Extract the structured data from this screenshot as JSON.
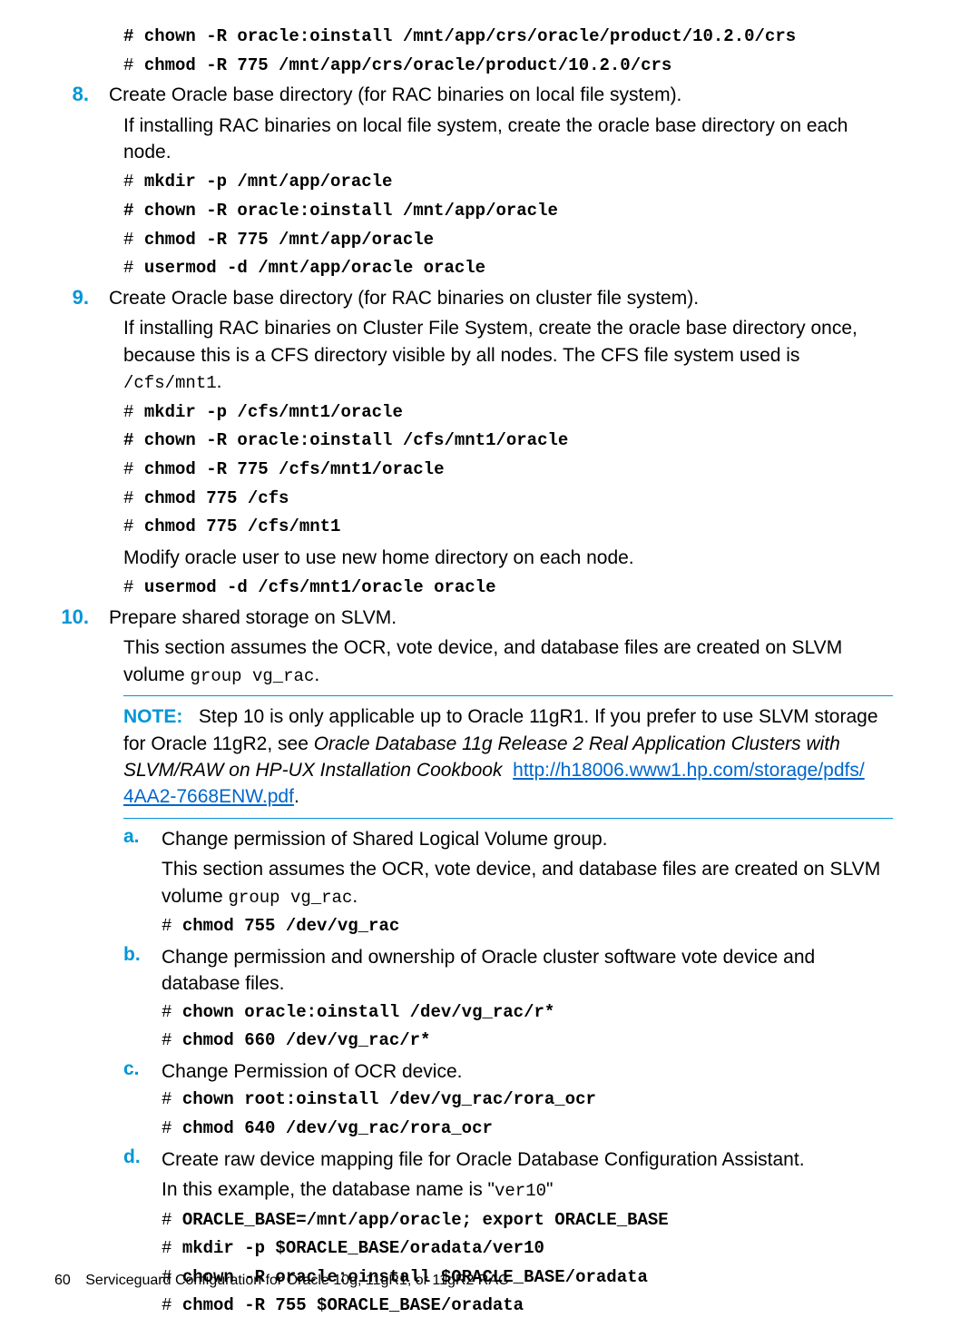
{
  "lines": {
    "l1": "# chown -R oracle:oinstall /mnt/app/crs/oracle/product/10.2.0/crs",
    "l2_pre": "# ",
    "l2_cmd": "chmod -R 775 /mnt/app/crs/oracle/product/10.2.0/crs"
  },
  "step8": {
    "num": "8.",
    "text": "Create Oracle base directory (for RAC binaries on local file system).",
    "para": "If installing RAC binaries on local file system, create the oracle base directory on each node.",
    "c1_pre": "# ",
    "c1_cmd": "mkdir -p /mnt/app/oracle",
    "c2": "# chown -R oracle:oinstall /mnt/app/oracle",
    "c3_pre": "# ",
    "c3_cmd": "chmod -R 775 /mnt/app/oracle",
    "c4_pre": "# ",
    "c4_cmd": "usermod -d /mnt/app/oracle oracle"
  },
  "step9": {
    "num": "9.",
    "text": "Create Oracle base directory (for RAC binaries on cluster file system).",
    "para_a": "If installing RAC binaries on Cluster File System, create the oracle base directory once, because this is a CFS directory visible by all nodes. The CFS file system used is ",
    "para_mono": "/cfs/mnt1",
    "para_end": ".",
    "c1_pre": "# ",
    "c1_cmd": "mkdir -p /cfs/mnt1/oracle",
    "c2": "# chown -R oracle:oinstall /cfs/mnt1/oracle",
    "c3_pre": "# ",
    "c3_cmd": "chmod -R 775 /cfs/mnt1/oracle",
    "c4_pre": "# ",
    "c4_cmd": "chmod 775 /cfs",
    "c5_pre": "# ",
    "c5_cmd": "chmod 775 /cfs/mnt1",
    "para2": "Modify oracle user to use new home directory on each node.",
    "c6_pre": "# ",
    "c6_cmd": "usermod -d /cfs/mnt1/oracle oracle"
  },
  "step10": {
    "num": "10.",
    "text": "Prepare shared storage on SLVM.",
    "para_a": "This section assumes the OCR, vote device, and database files are created on SLVM volume ",
    "para_mono": "group vg_rac",
    "para_end": "."
  },
  "note": {
    "label": "NOTE:",
    "t1": "Step 10 is only applicable up to Oracle 11gR1. If you prefer to use SLVM storage for Oracle 11gR2, see ",
    "italic": "Oracle Database 11g Release 2 Real Application Clusters with SLVM/RAW on HP-UX Installation Cookbook",
    "link1": "http://h18006.www1.hp.com/storage/pdfs/",
    "link2": "4AA2-7668ENW.pdf",
    "after": "."
  },
  "sub_a": {
    "label": "a.",
    "text": "Change permission of Shared Logical Volume group.",
    "para_a": "This section assumes the OCR, vote device, and database files are created on SLVM volume ",
    "para_mono": "group vg_rac",
    "para_end": ".",
    "c1_pre": "# ",
    "c1_cmd": "chmod 755 /dev/vg_rac"
  },
  "sub_b": {
    "label": "b.",
    "text": "Change permission and ownership of Oracle cluster software vote device and database files.",
    "c1_pre": "# ",
    "c1_cmd": "chown oracle:oinstall /dev/vg_rac/r*",
    "c2_pre": "# ",
    "c2_cmd": "chmod 660 /dev/vg_rac/r*"
  },
  "sub_c": {
    "label": "c.",
    "text": "Change Permission of OCR device.",
    "c1_pre": "# ",
    "c1_cmd": "chown root:oinstall /dev/vg_rac/rora_ocr",
    "c2_pre": "# ",
    "c2_cmd": "chmod 640 /dev/vg_rac/rora_ocr"
  },
  "sub_d": {
    "label": "d.",
    "text": "Create raw device mapping file for Oracle Database Configuration Assistant.",
    "para_a": "In this example, the database name is \"",
    "para_mono": "ver10",
    "para_end": "\"",
    "c1_pre": "# ",
    "c1_cmd": "ORACLE_BASE=/mnt/app/oracle; export ORACLE_BASE",
    "c2_pre": "# ",
    "c2_cmd": "mkdir -p $ORACLE_BASE/oradata/ver10",
    "c3_pre": "# ",
    "c3_cmd": "chown -R oracle:oinstall $ORACLE_BASE/oradata",
    "c4_pre": "# ",
    "c4_cmd": "chmod -R 755 $ORACLE_BASE/oradata"
  },
  "footer": {
    "pagenum": "60",
    "title": "Serviceguard Configuration for Oracle 10g, 11gR1, or 11gR2 RAC"
  }
}
